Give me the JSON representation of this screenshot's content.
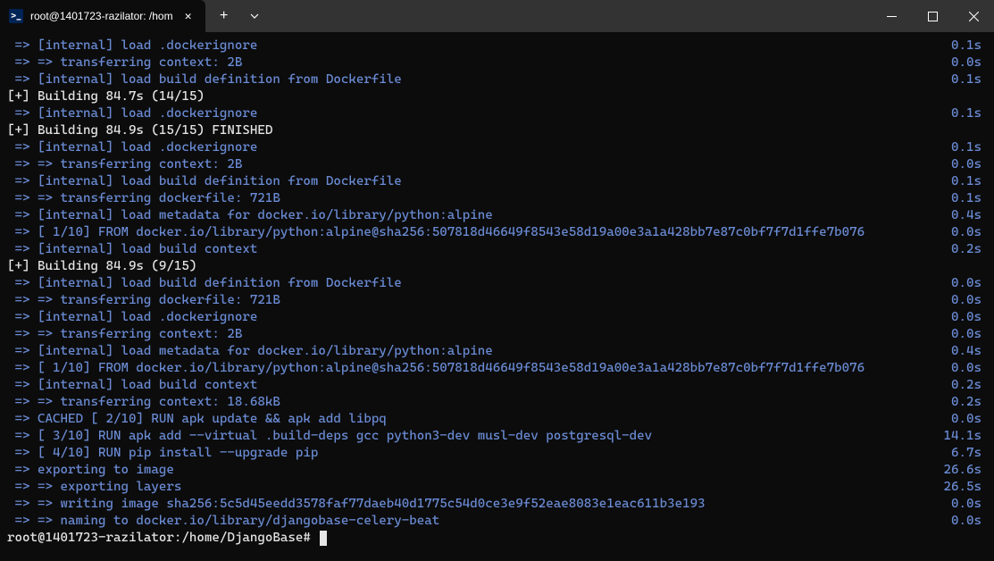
{
  "titlebar": {
    "tab_title": "root@1401723-razilator: /hom",
    "tab_icon_text": ">_"
  },
  "lines": [
    {
      "text": " => [internal] load .dockerignore",
      "time": "0.1s",
      "color": "blue"
    },
    {
      "text": " => => transferring context: 2B",
      "time": "0.0s",
      "color": "blue"
    },
    {
      "text": " => [internal] load build definition from Dockerfile",
      "time": "0.1s",
      "color": "blue"
    },
    {
      "text": "[+] Building 84.7s (14/15)",
      "time": "",
      "color": "white"
    },
    {
      "text": " => [internal] load .dockerignore",
      "time": "0.1s",
      "color": "blue"
    },
    {
      "text": "[+] Building 84.9s (15/15) FINISHED",
      "time": "",
      "color": "white"
    },
    {
      "text": " => [internal] load .dockerignore",
      "time": "0.1s",
      "color": "blue"
    },
    {
      "text": " => => transferring context: 2B",
      "time": "0.0s",
      "color": "blue"
    },
    {
      "text": " => [internal] load build definition from Dockerfile",
      "time": "0.1s",
      "color": "blue"
    },
    {
      "text": " => => transferring dockerfile: 721B",
      "time": "0.1s",
      "color": "blue"
    },
    {
      "text": " => [internal] load metadata for docker.io/library/python:alpine",
      "time": "0.4s",
      "color": "blue"
    },
    {
      "text": " => [ 1/10] FROM docker.io/library/python:alpine@sha256:507818d46649f8543e58d19a00e3a1a428bb7e87c0bf7f7d1ffe7b076",
      "time": "0.0s",
      "color": "blue"
    },
    {
      "text": " => [internal] load build context",
      "time": "0.2s",
      "color": "blue"
    },
    {
      "text": "[+] Building 84.9s (9/15)",
      "time": "",
      "color": "white"
    },
    {
      "text": " => [internal] load build definition from Dockerfile",
      "time": "0.0s",
      "color": "blue"
    },
    {
      "text": " => => transferring dockerfile: 721B",
      "time": "0.0s",
      "color": "blue"
    },
    {
      "text": " => [internal] load .dockerignore",
      "time": "0.0s",
      "color": "blue"
    },
    {
      "text": " => => transferring context: 2B",
      "time": "0.0s",
      "color": "blue"
    },
    {
      "text": " => [internal] load metadata for docker.io/library/python:alpine",
      "time": "0.4s",
      "color": "blue"
    },
    {
      "text": " => [ 1/10] FROM docker.io/library/python:alpine@sha256:507818d46649f8543e58d19a00e3a1a428bb7e87c0bf7f7d1ffe7b076",
      "time": "0.0s",
      "color": "blue"
    },
    {
      "text": " => [internal] load build context",
      "time": "0.2s",
      "color": "blue"
    },
    {
      "text": " => => transferring context: 18.68kB",
      "time": "0.2s",
      "color": "blue"
    },
    {
      "text": " => CACHED [ 2/10] RUN apk update && apk add libpq",
      "time": "0.0s",
      "color": "blue"
    },
    {
      "text": " => [ 3/10] RUN apk add --virtual .build-deps gcc python3-dev musl-dev postgresql-dev",
      "time": "14.1s",
      "color": "blue"
    },
    {
      "text": " => [ 4/10] RUN pip install --upgrade pip",
      "time": "6.7s",
      "color": "blue"
    },
    {
      "text": " => exporting to image",
      "time": "26.6s",
      "color": "blue"
    },
    {
      "text": " => => exporting layers",
      "time": "26.5s",
      "color": "blue"
    },
    {
      "text": " => => writing image sha256:5c5d45eedd3578faf77daeb40d1775c54d0ce3e9f52eae8083e1eac611b3e193",
      "time": "0.0s",
      "color": "blue"
    },
    {
      "text": " => => naming to docker.io/library/djangobase-celery-beat",
      "time": "0.0s",
      "color": "blue"
    }
  ],
  "prompt": "root@1401723-razilator:/home/DjangoBase# "
}
